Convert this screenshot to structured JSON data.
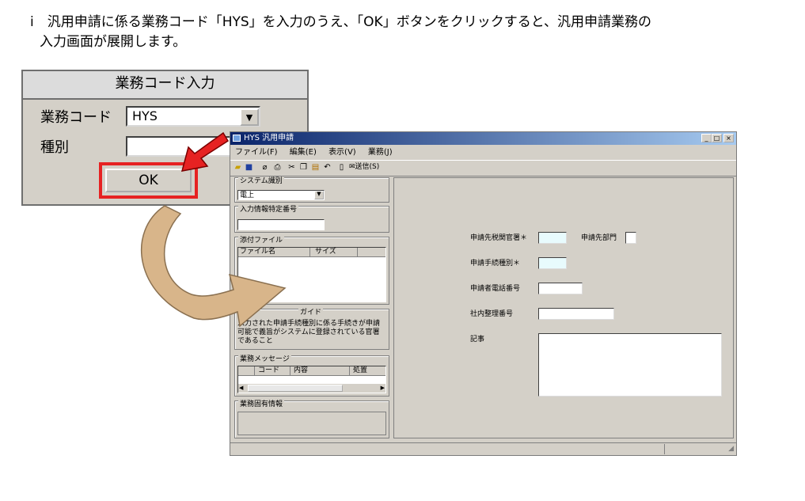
{
  "instruction": {
    "line1": "i　汎用申請に係る業務コード「HYS」を入力のうえ、「OK」ボタンをクリックすると、汎用申請業務の",
    "line2": "入力画面が展開します。"
  },
  "code_dialog": {
    "title": "業務コード入力",
    "code_label": "業務コード",
    "code_value": "HYS",
    "type_label": "種別",
    "type_value": "",
    "ok_label": "OK"
  },
  "app_window": {
    "title": "HYS 汎用申請",
    "menu": [
      "ファイル(F)",
      "編集(E)",
      "表示(V)",
      "業務(J)"
    ],
    "toolbar_send": "送信(S)",
    "left": {
      "system_type_label": "システム識別",
      "system_type_value": "電上",
      "input_id_label": "入力情報特定番号",
      "input_id_value": "",
      "attachments_label": "添付ファイル",
      "attachments_columns": [
        "ファイル名",
        "サイズ"
      ],
      "guide_label": "ガイド",
      "guide_text": "入力された申請手続種別に係る手続きが申請可能で義旨がシステムに登録されている官署であること",
      "messages_label": "業務メッセージ",
      "messages_columns": [
        "コード",
        "内容",
        "処置"
      ],
      "specific_info_label": "業務固有情報"
    },
    "right": {
      "dest_office_label": "申請先税関官署＊",
      "dest_dept_label": "申請先部門",
      "procedure_type_label": "申請手続種別＊",
      "phone_label": "申請者電話番号",
      "ref_no_label": "社内整理番号",
      "notes_label": "記事"
    }
  },
  "colors": {
    "highlight": "#e62222",
    "arrow_fill": "#d8b58a",
    "title_bar": "#0a246a"
  }
}
